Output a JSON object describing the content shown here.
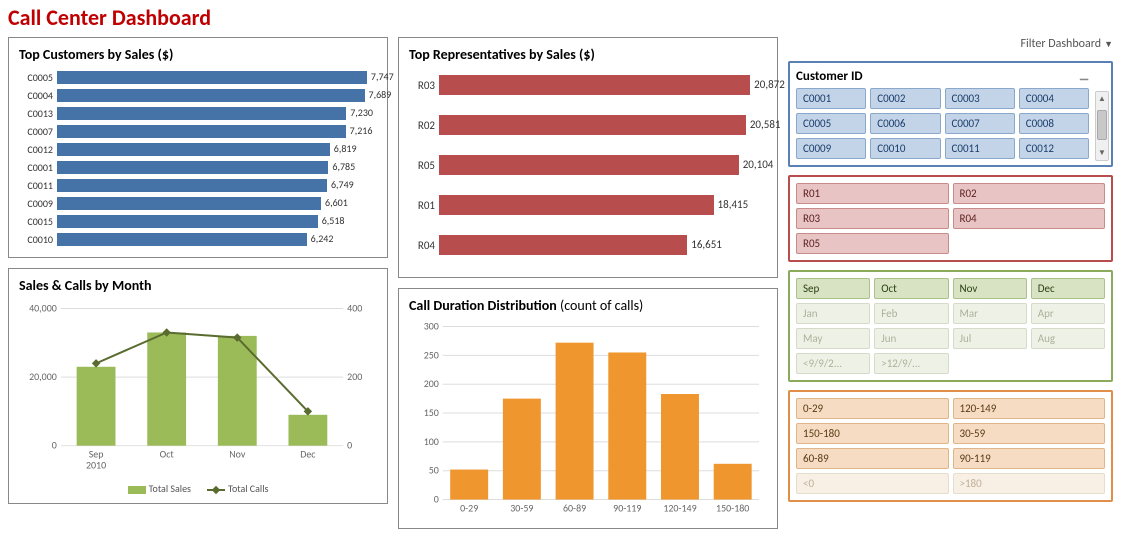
{
  "title": "Call Center Dashboard",
  "filter_label": "Filter Dashboard",
  "panels": {
    "top_cust": "Top Customers by Sales ($)",
    "top_rep": "Top Representatives by Sales ($)",
    "sales_calls": "Sales & Calls by Month",
    "duration": "Call Duration Distribution",
    "duration_sub": " (count of calls)"
  },
  "legend": {
    "sales": "Total Sales",
    "calls": "Total Calls"
  },
  "slicers": {
    "customer_header": "Customer ID",
    "customers": [
      "C0001",
      "C0002",
      "C0003",
      "C0004",
      "C0005",
      "C0006",
      "C0007",
      "C0008",
      "C0009",
      "C0010",
      "C0011",
      "C0012"
    ],
    "reps": [
      "R01",
      "R02",
      "R03",
      "R04",
      "R05"
    ],
    "months_active": [
      "Sep",
      "Oct",
      "Nov",
      "Dec"
    ],
    "months_inactive": [
      "Jan",
      "Feb",
      "Mar",
      "Apr",
      "May",
      "Jun",
      "Jul",
      "Aug",
      "<9/9/2...",
      ">12/9/..."
    ],
    "bins_active": [
      "0-29",
      "120-149",
      "150-180",
      "30-59",
      "60-89",
      "90-119"
    ],
    "bins_inactive": [
      "<0",
      ">180"
    ]
  },
  "chart_data": [
    {
      "id": "top_customers",
      "type": "bar",
      "orientation": "horizontal",
      "title": "Top Customers by Sales ($)",
      "categories": [
        "C0005",
        "C0004",
        "C0013",
        "C0007",
        "C0012",
        "C0001",
        "C0011",
        "C0009",
        "C0015",
        "C0010"
      ],
      "values": [
        7747,
        7689,
        7230,
        7216,
        6819,
        6785,
        6749,
        6601,
        6518,
        6242
      ],
      "xlim": [
        0,
        8000
      ]
    },
    {
      "id": "top_reps",
      "type": "bar",
      "orientation": "horizontal",
      "title": "Top Representatives by Sales ($)",
      "categories": [
        "R03",
        "R02",
        "R05",
        "R01",
        "R04"
      ],
      "values": [
        20872,
        20581,
        20104,
        18415,
        16651
      ],
      "xlim": [
        0,
        22000
      ]
    },
    {
      "id": "sales_calls",
      "type": "combo",
      "title": "Sales & Calls by Month",
      "categories": [
        "Sep",
        "Oct",
        "Nov",
        "Dec"
      ],
      "year_label": "2010",
      "series": [
        {
          "name": "Total Sales",
          "type": "bar",
          "axis": "left",
          "values": [
            23000,
            33000,
            32000,
            9000
          ]
        },
        {
          "name": "Total Calls",
          "type": "line",
          "axis": "right",
          "values": [
            240,
            330,
            315,
            100
          ]
        }
      ],
      "ylim_left": [
        0,
        40000
      ],
      "yticks_left": [
        0,
        20000,
        40000
      ],
      "ylim_right": [
        0,
        400
      ],
      "yticks_right": [
        0,
        200,
        400
      ]
    },
    {
      "id": "duration",
      "type": "bar",
      "orientation": "vertical",
      "title": "Call Duration Distribution (count of calls)",
      "categories": [
        "0-29",
        "30-59",
        "60-89",
        "90-119",
        "120-149",
        "150-180"
      ],
      "values": [
        52,
        175,
        272,
        255,
        183,
        62
      ],
      "ylim": [
        0,
        300
      ],
      "yticks": [
        0,
        50,
        100,
        150,
        200,
        250,
        300
      ]
    }
  ]
}
